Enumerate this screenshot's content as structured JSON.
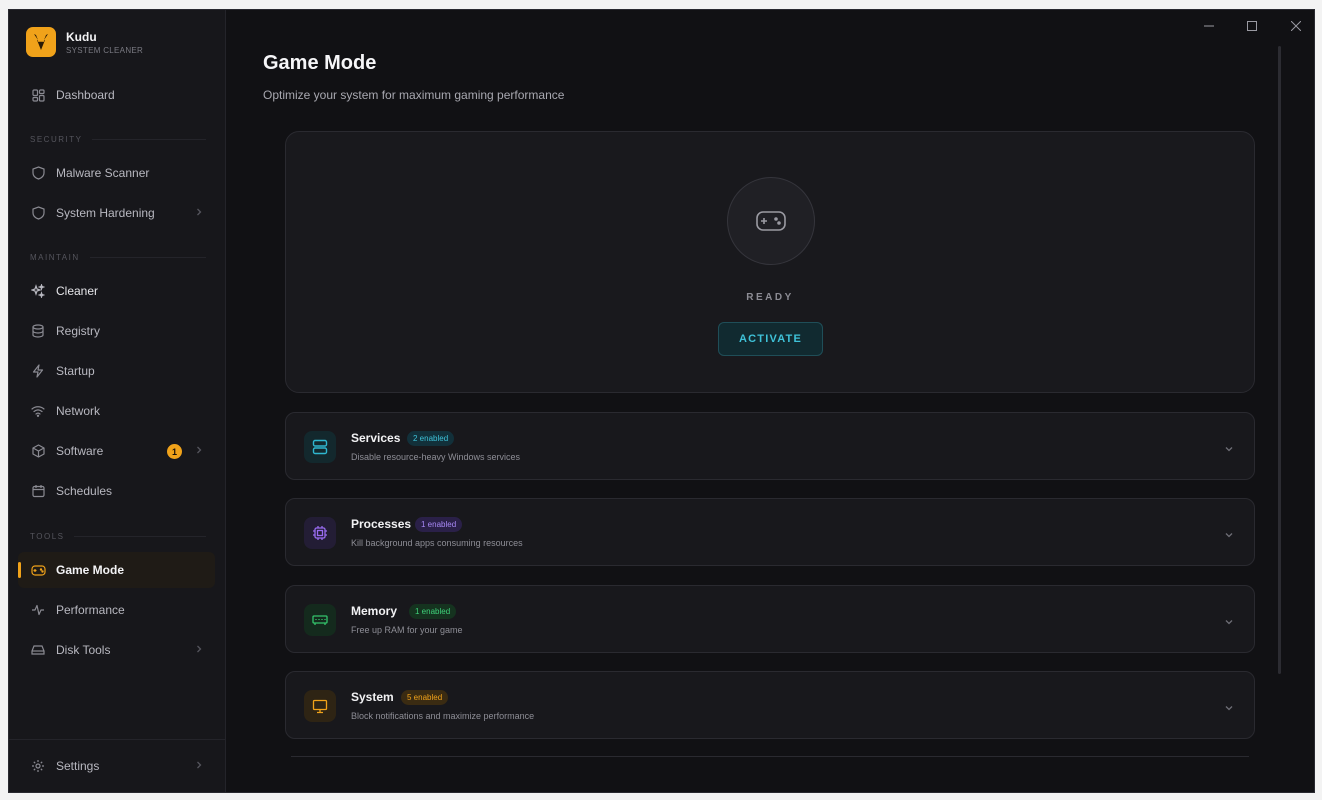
{
  "app": {
    "name": "Kudu",
    "subtitle": "SYSTEM CLEANER"
  },
  "sidebar": {
    "dashboard": "Dashboard",
    "sections": {
      "security": "SECURITY",
      "maintain": "MAINTAIN",
      "tools": "TOOLS"
    },
    "items": {
      "malware": "Malware Scanner",
      "hardening": "System Hardening",
      "cleaner": "Cleaner",
      "registry": "Registry",
      "startup": "Startup",
      "network": "Network",
      "software": "Software",
      "software_badge": "1",
      "schedules": "Schedules",
      "gamemode": "Game Mode",
      "performance": "Performance",
      "disktools": "Disk Tools",
      "settings": "Settings"
    }
  },
  "page": {
    "title": "Game Mode",
    "subtitle": "Optimize your system for maximum gaming performance",
    "status": "READY",
    "activate": "ACTIVATE"
  },
  "cards": [
    {
      "title": "Services",
      "badge": "2 enabled",
      "desc": "Disable resource-heavy Windows services",
      "color": "#2fb6cf"
    },
    {
      "title": "Processes",
      "badge": "1 enabled",
      "desc": "Kill background apps consuming resources",
      "color": "#9a6cf2"
    },
    {
      "title": "Memory",
      "badge": "1 enabled",
      "desc": "Free up RAM for your game",
      "color": "#34c46b"
    },
    {
      "title": "System",
      "badge": "5 enabled",
      "desc": "Block notifications and maximize performance",
      "color": "#f0a21a"
    }
  ],
  "colors": {
    "accent": "#f0a21a",
    "cyan": "#3fc2d8",
    "background": "#111114"
  }
}
